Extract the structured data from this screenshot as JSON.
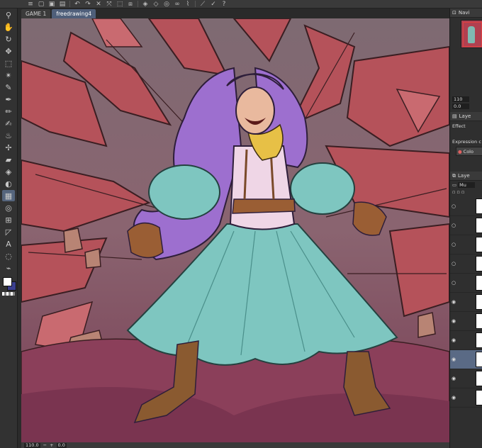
{
  "app": {
    "tabs": [
      {
        "label": "GAME 1",
        "active": false
      },
      {
        "label": "freedrawing4",
        "active": true
      }
    ]
  },
  "top_toolbar": {
    "icons": [
      "menu-icon",
      "new-file-icon",
      "open-file-icon",
      "save-icon",
      "undo-icon",
      "redo-icon",
      "clear-icon",
      "transform-icon",
      "deselect-icon",
      "invert-selection-icon",
      "fill-icon",
      "eraser-icon",
      "selection-launcher-icon",
      "lasso-icon",
      "brush-settings-icon",
      "ruler-icon",
      "snap-icon",
      "help-icon"
    ]
  },
  "tools": [
    {
      "name": "zoom-tool",
      "glyph": "⚲"
    },
    {
      "name": "hand-tool",
      "glyph": "✋"
    },
    {
      "name": "rotate-tool",
      "glyph": "↻"
    },
    {
      "name": "move-tool",
      "glyph": "✥"
    },
    {
      "name": "selection-tool",
      "glyph": "⬚"
    },
    {
      "name": "magic-wand-tool",
      "glyph": "✴"
    },
    {
      "name": "eyedropper-tool",
      "glyph": "✎"
    },
    {
      "name": "pen-tool",
      "glyph": "✒"
    },
    {
      "name": "pencil-tool",
      "glyph": "✏"
    },
    {
      "name": "brush-tool",
      "glyph": "✍"
    },
    {
      "name": "airbrush-tool",
      "glyph": "♨"
    },
    {
      "name": "decoration-tool",
      "glyph": "✢"
    },
    {
      "name": "eraser-tool",
      "glyph": "▰"
    },
    {
      "name": "blend-tool",
      "glyph": "◈"
    },
    {
      "name": "fill-tool",
      "glyph": "◐"
    },
    {
      "name": "gradient-tool",
      "glyph": "▦"
    },
    {
      "name": "figure-tool",
      "glyph": "◎"
    },
    {
      "name": "frame-tool",
      "glyph": "⊞"
    },
    {
      "name": "ruler-tool",
      "glyph": "◸"
    },
    {
      "name": "text-tool",
      "glyph": "A"
    },
    {
      "name": "balloon-tool",
      "glyph": "◌"
    },
    {
      "name": "line-correction-tool",
      "glyph": "⌁"
    }
  ],
  "colors": {
    "main": "#ffffff",
    "sub": "#3b3f8e",
    "canvas_bg": "#5e5a64"
  },
  "status": {
    "zoom": "110.0",
    "angle": "0.0"
  },
  "right_panel": {
    "navigator_tab": "Navi",
    "nav_zoom": "110",
    "nav_angle": "0.0",
    "property_tab": "Laye",
    "effect_label": "Effect",
    "expression_label": "Expression c",
    "color_button": "Colo",
    "layer_tab": "Laye",
    "blend_mode": "Mu"
  },
  "layers": [
    {
      "visible": false,
      "selected": false
    },
    {
      "visible": false,
      "selected": false
    },
    {
      "visible": false,
      "selected": false
    },
    {
      "visible": false,
      "selected": false
    },
    {
      "visible": false,
      "selected": false
    },
    {
      "visible": true,
      "selected": false
    },
    {
      "visible": true,
      "selected": false
    },
    {
      "visible": true,
      "selected": false
    },
    {
      "visible": true,
      "selected": true
    },
    {
      "visible": true,
      "selected": false
    },
    {
      "visible": true,
      "selected": false
    }
  ]
}
